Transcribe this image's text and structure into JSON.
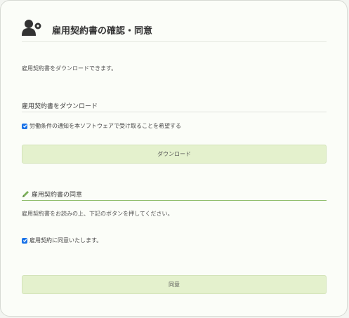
{
  "header": {
    "title": "雇用契約書の確認・同意",
    "icon": "user-settings-icon"
  },
  "description": "雇用契約書をダウンロードできます。",
  "download_section": {
    "heading": "雇用契約書をダウンロード",
    "checkbox_label": "労働条件の通知を本ソフトウェアで受け取ることを希望する",
    "checked": true,
    "button_label": "ダウンロード"
  },
  "agree_section": {
    "heading": "雇用契約書の同意",
    "icon": "pencil-icon",
    "instruction": "雇用契約書をお読みの上、下記のボタンを押してください。",
    "checkbox_label": "雇用契約に同意いたします。",
    "checked": true,
    "button_label": "同意"
  },
  "colors": {
    "button_bg": "#e4f1cd",
    "accent_line": "#8fbd6a",
    "checkbox": "#1a73e8"
  }
}
